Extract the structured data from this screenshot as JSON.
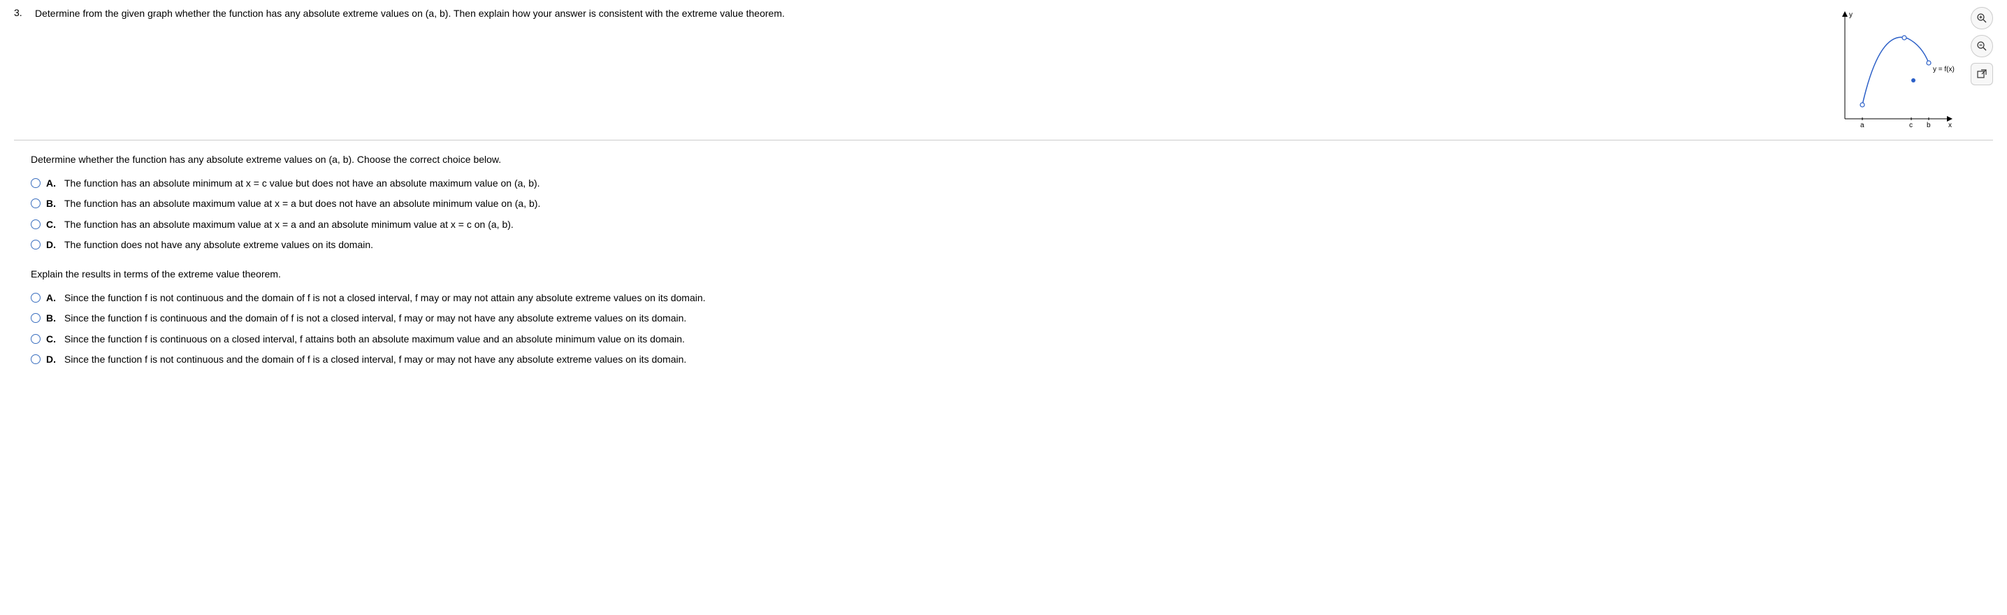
{
  "question_number": "3.",
  "question_text": "Determine from the given graph whether the function has any absolute extreme values on (a, b). Then explain how your answer is consistent with the extreme value theorem.",
  "graph": {
    "y_axis_label": "y",
    "x_axis_label": "x",
    "function_label": "y = f(x)",
    "ticks": [
      "a",
      "c",
      "b"
    ]
  },
  "tools": {
    "zoom_in": "zoom-in",
    "zoom_out": "zoom-out",
    "open_new": "open-new-window"
  },
  "part1": {
    "prompt": "Determine whether the function has any absolute extreme values on (a, b). Choose the correct choice below.",
    "choices": [
      {
        "label": "A.",
        "text": "The function has an absolute minimum at x = c value but does not have an absolute maximum value on (a, b)."
      },
      {
        "label": "B.",
        "text": "The function has an absolute maximum value at x = a but does not have an absolute minimum value on (a, b)."
      },
      {
        "label": "C.",
        "text": "The function has an absolute maximum value at x = a and an absolute minimum value at x = c on (a, b)."
      },
      {
        "label": "D.",
        "text": "The function does not have any absolute extreme values on its domain."
      }
    ]
  },
  "part2": {
    "prompt": "Explain the results in terms of the extreme value theorem.",
    "choices": [
      {
        "label": "A.",
        "text": "Since the function f is not continuous and the domain of f is not a closed interval, f may or may not attain any absolute extreme values on its domain."
      },
      {
        "label": "B.",
        "text": "Since the function f is continuous and the domain of f is not a closed interval, f may or may not have any absolute extreme values on its domain."
      },
      {
        "label": "C.",
        "text": "Since the function f is continuous on a closed interval, f attains both an absolute maximum value and an absolute minimum value on its domain."
      },
      {
        "label": "D.",
        "text": "Since the function f is not continuous and the domain of f is a closed interval, f may or may not have any absolute extreme values on its domain."
      }
    ]
  },
  "chart_data": {
    "type": "line",
    "title": "",
    "xlabel": "x",
    "ylabel": "y",
    "function_label": "y = f(x)",
    "x_ticks": [
      "a",
      "c",
      "b"
    ],
    "description": "Curve from open endpoint at x=a rising to an open-circled maximum near x=c, then decreasing to an open endpoint at x=b. A separate filled point lies below the curve near x=c (removable discontinuity).",
    "endpoints": {
      "a": "open",
      "b": "open"
    },
    "discontinuity_at": "c",
    "series": [
      {
        "name": "f(x)",
        "x": [
          "a",
          "c",
          "b"
        ],
        "y_relative": [
          0.15,
          1.0,
          0.8
        ],
        "open_points": [
          "a",
          "c",
          "b"
        ]
      },
      {
        "name": "f(c) actual",
        "x": [
          "c"
        ],
        "y_relative": [
          0.55
        ],
        "point_style": "filled"
      }
    ]
  }
}
